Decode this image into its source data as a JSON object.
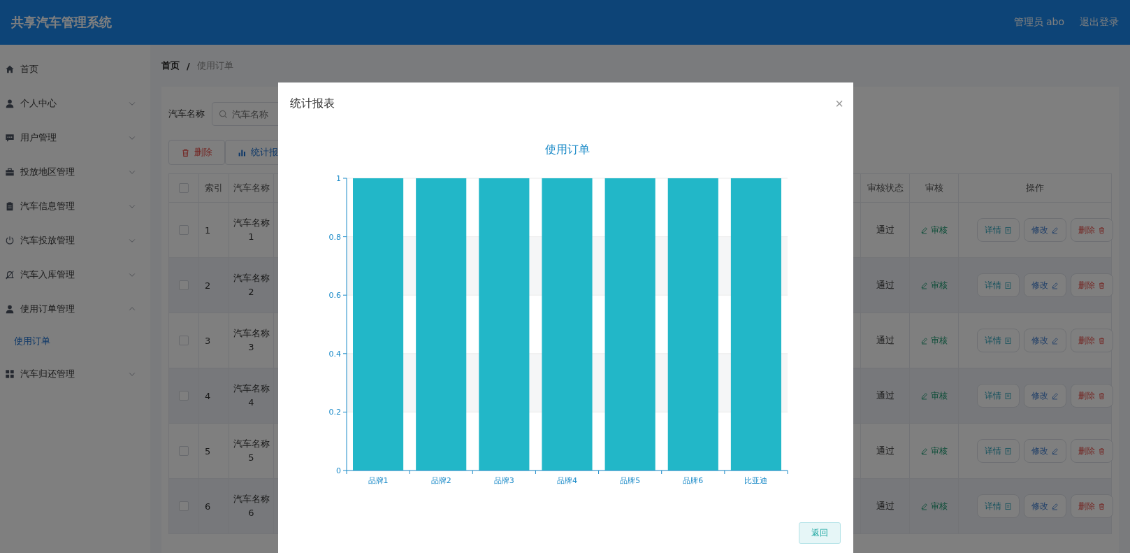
{
  "header": {
    "title": "共享汽车管理系统",
    "user": "管理员 abo",
    "logout": "退出登录"
  },
  "sidebar": {
    "items": [
      {
        "label": "首页",
        "selected": false
      },
      {
        "label": "个人中心",
        "expanded": false,
        "selected": false
      },
      {
        "label": "用户管理",
        "expanded": false,
        "selected": false
      },
      {
        "label": "投放地区管理",
        "expanded": false,
        "selected": false
      },
      {
        "label": "汽车信息管理",
        "expanded": false,
        "selected": false
      },
      {
        "label": "汽车投放管理",
        "expanded": false,
        "selected": false
      },
      {
        "label": "汽车入库管理",
        "expanded": false,
        "selected": false
      },
      {
        "label": "使用订单管理",
        "expanded": true,
        "selected": false,
        "children": [
          {
            "label": "使用订单",
            "selected": true
          }
        ]
      },
      {
        "label": "汽车归还管理",
        "expanded": false,
        "selected": false
      }
    ]
  },
  "breadcrumb": {
    "items": [
      "首页",
      "使用订单"
    ],
    "separator": "/"
  },
  "search": {
    "label": "汽车名称",
    "placeholder": "汽车名称"
  },
  "toolbar": [
    {
      "kind": "delete",
      "label": "删除"
    },
    {
      "kind": "chart",
      "label": "统计报"
    }
  ],
  "table": {
    "select_all": {
      "checked": false
    },
    "columns_left": [
      "索引",
      "汽车名称"
    ],
    "columns_right": [
      "审核状态",
      "审核",
      "操作"
    ],
    "rows": [
      {
        "checked": false,
        "index": "1",
        "name": "汽车名称 1",
        "status": "通过",
        "audit": "审核",
        "actions": [
          "详情",
          "修改",
          "删除"
        ]
      },
      {
        "checked": false,
        "index": "2",
        "name": "汽车名称 2",
        "status": "通过",
        "audit": "审核",
        "actions": [
          "详情",
          "修改",
          "删除"
        ]
      },
      {
        "checked": false,
        "index": "3",
        "name": "汽车名称 3",
        "status": "通过",
        "audit": "审核",
        "actions": [
          "详情",
          "修改",
          "删除"
        ]
      },
      {
        "checked": false,
        "index": "4",
        "name": "汽车名称 4",
        "status": "通过",
        "audit": "审核",
        "actions": [
          "详情",
          "修改",
          "删除"
        ]
      },
      {
        "checked": false,
        "index": "5",
        "name": "汽车名称 5",
        "status": "通过",
        "audit": "审核",
        "actions": [
          "详情",
          "修改",
          "删除"
        ]
      },
      {
        "checked": false,
        "index": "6",
        "name": "汽车名称 6",
        "status": "通过",
        "audit": "审核",
        "actions": [
          "详情",
          "修改",
          "删除"
        ]
      }
    ]
  },
  "dialog": {
    "title": "统计报表",
    "close": "×",
    "button": "返回",
    "chart_data": {
      "type": "bar",
      "title": "使用订单",
      "categories": [
        "品牌1",
        "品牌2",
        "品牌3",
        "品牌4",
        "品牌5",
        "品牌6",
        "比亚迪"
      ],
      "values": [
        1,
        1,
        1,
        1,
        1,
        1,
        1
      ],
      "ylim": [
        0,
        1
      ],
      "yticks": [
        0,
        0.2,
        0.4,
        0.6,
        0.8,
        1
      ],
      "grid": true
    }
  }
}
